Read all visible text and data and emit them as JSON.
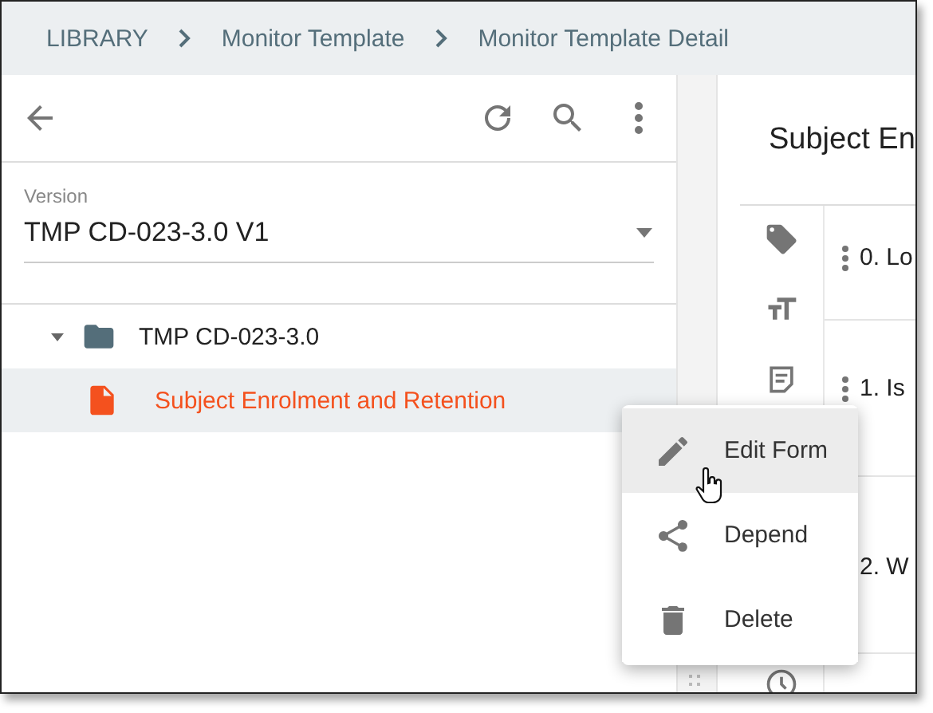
{
  "breadcrumb": [
    {
      "label": "LIBRARY"
    },
    {
      "label": "Monitor Template"
    },
    {
      "label": "Monitor Template Detail"
    }
  ],
  "version_field": {
    "label": "Version",
    "value": "TMP CD-023-3.0 V1"
  },
  "tree": [
    {
      "label": "TMP CD-023-3.0",
      "kind": "folder",
      "expanded": true,
      "selected": false,
      "children": [
        {
          "label": "Subject Enrolment and Retention",
          "kind": "document",
          "selected": true
        }
      ]
    }
  ],
  "detail": {
    "title": "Subject En",
    "rows": [
      {
        "label": "0. Lo",
        "actions": true
      },
      {
        "label": "1. Is",
        "actions": true
      },
      {
        "label": "2. W"
      }
    ]
  },
  "context_menu": [
    {
      "label": "Edit Form",
      "kind": "edit",
      "selected": true
    },
    {
      "label": "Depend",
      "kind": "share",
      "selected": false
    },
    {
      "label": "Delete",
      "kind": "delete",
      "selected": false
    }
  ]
}
